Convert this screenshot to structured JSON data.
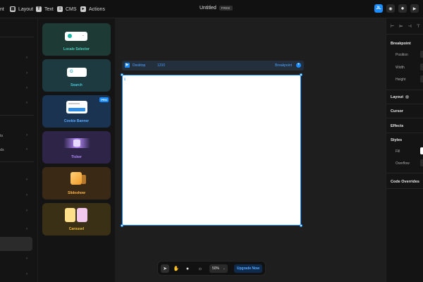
{
  "topbar": {
    "tools": [
      {
        "label": "nt",
        "icon": "insert-icon"
      },
      {
        "label": "Layout",
        "icon": "layout-icon"
      },
      {
        "label": "Text",
        "icon": "text-icon"
      },
      {
        "label": "CMS",
        "icon": "cms-icon"
      },
      {
        "label": "Actions",
        "icon": "actions-icon"
      }
    ],
    "title": "Untitled",
    "plan_badge": "FREE",
    "avatar": "JL"
  },
  "leftnav": {
    "text_1": "ts",
    "text_2": "ds"
  },
  "insert_panel": {
    "cards": [
      {
        "label": "Locale Selector",
        "color": "#22b8a6"
      },
      {
        "label": "Search",
        "color": "#2fb6c9"
      },
      {
        "label": "Cookie Banner",
        "color": "#2e8fe8",
        "pro": "PRO"
      },
      {
        "label": "Ticker",
        "color": "#a86bff"
      },
      {
        "label": "Slideshow",
        "color": "#f0a640"
      },
      {
        "label": "Carousel",
        "color": "#e9b43a"
      }
    ]
  },
  "canvas": {
    "frame_name": "Desktop",
    "frame_size": "1200",
    "breakpoint_label": "Breakpoint",
    "frame_tag": "[]",
    "zoom": "50%",
    "upgrade_label": "Upgrade Now"
  },
  "rightpanel": {
    "breakpoint_title": "Breakpoint",
    "position_label": "Position",
    "width_label": "Width",
    "height_label": "Height",
    "layout_title": "Layout",
    "cursor_title": "Cursor",
    "effects_title": "Effects",
    "styles_title": "Styles",
    "fill_label": "Fill",
    "overflow_label": "Overflow",
    "code_overrides_title": "Code Overrides"
  },
  "colors": {
    "accent": "#1a8cff",
    "background": "#1e1e1e",
    "panel": "#141414"
  }
}
